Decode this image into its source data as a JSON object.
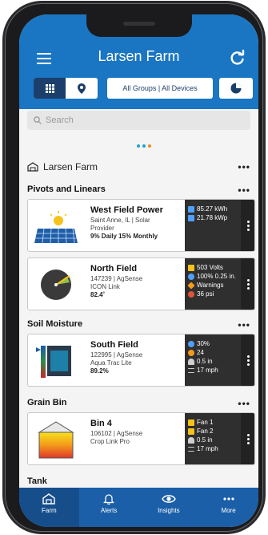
{
  "header": {
    "title": "Larsen Farm",
    "groups_label": "All Groups  |  All Devices"
  },
  "search": {
    "placeholder": "Search"
  },
  "farm": {
    "name": "Larsen Farm",
    "more": "•••"
  },
  "sections": [
    {
      "title": "Pivots and Linears",
      "more": "•••"
    },
    {
      "title": "Soil Moisture",
      "more": "•••"
    },
    {
      "title": "Grain Bin",
      "more": "•••"
    },
    {
      "title": "Tank"
    }
  ],
  "cards": [
    {
      "name": "West Field Power",
      "lines": [
        "Saint Anne, IL | Solar",
        "Provider"
      ],
      "bold": "9% Daily    15% Monthly",
      "stats": [
        {
          "icon": "lightning-icon",
          "color": "#4fa0ff",
          "text": "85.27 kWh"
        },
        {
          "icon": "solar-panel-icon",
          "color": "#4fa0ff",
          "text": "21.78 kWp"
        }
      ]
    },
    {
      "name": "North Field",
      "lines": [
        "147239 | AgSense",
        "ICON Link"
      ],
      "bold": "82.4˚",
      "stats": [
        {
          "icon": "lightning-icon",
          "color": "#f3c21b",
          "text": "503 Volts"
        },
        {
          "icon": "water-drop-icon",
          "color": "#4fa0ff",
          "text": "100% 0.25 in."
        },
        {
          "icon": "warning-icon",
          "color": "#f39a1b",
          "text": "Warnings"
        },
        {
          "icon": "pressure-gauge-icon",
          "color": "#e0553a",
          "text": "36 psi"
        }
      ]
    },
    {
      "name": "South Field",
      "lines": [
        "122995 | AgSense",
        "Aqua Trac Lite"
      ],
      "bold": "89.2%",
      "stats": [
        {
          "icon": "thermometer-drops-icon",
          "color": "#4fa0ff",
          "text": "30%"
        },
        {
          "icon": "sun-icon",
          "color": "#f39a1b",
          "text": "24"
        },
        {
          "icon": "rain-icon",
          "color": "#cfcfcf",
          "text": "0.5 in"
        },
        {
          "icon": "wind-icon",
          "color": "#cfcfcf",
          "text": "17 mph"
        }
      ]
    },
    {
      "name": "Bin 4",
      "lines": [
        "106102 | AgSense",
        "Crop Link Pro"
      ],
      "bold": "",
      "stats": [
        {
          "icon": "fan-icon",
          "color": "#f3c21b",
          "text": "Fan 1"
        },
        {
          "icon": "fan-icon",
          "color": "#f3c21b",
          "text": "Fan 2"
        },
        {
          "icon": "rain-icon",
          "color": "#cfcfcf",
          "text": "0.5 in"
        },
        {
          "icon": "wind-icon",
          "color": "#cfcfcf",
          "text": "17 mph"
        }
      ]
    }
  ],
  "nav": [
    {
      "label": "Farm",
      "icon": "farm-icon",
      "active": true
    },
    {
      "label": "Alerts",
      "icon": "bell-icon"
    },
    {
      "label": "Insights",
      "icon": "eye-icon"
    },
    {
      "label": "More",
      "icon": "more-icon"
    }
  ],
  "colors": {
    "header": "#1a76c2",
    "nav": "#1a5fa8",
    "dark_button": "#1b3e6a"
  }
}
